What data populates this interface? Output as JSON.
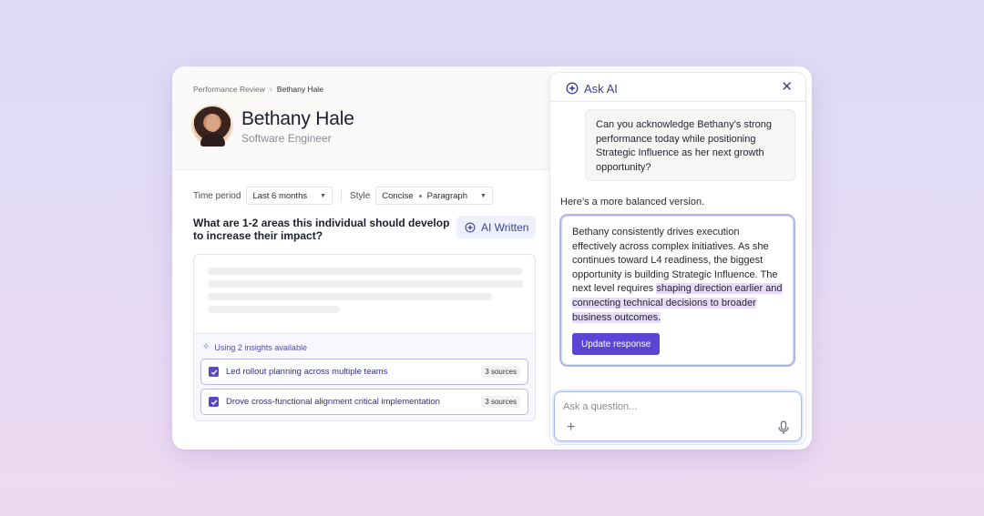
{
  "breadcrumb": {
    "parent": "Performance Review",
    "current": "Bethany Hale"
  },
  "profile": {
    "name": "Bethany Hale",
    "role": "Software Engineer"
  },
  "filters": {
    "time_label": "Time period",
    "time_value": "Last 6 months",
    "style_label": "Style",
    "style_value_1": "Concise",
    "style_value_2": "Paragraph"
  },
  "question": "What are 1-2 areas this individual should develop to increase their impact?",
  "ai_written_label": "AI Written",
  "insights": {
    "header": "Using 2 insights available",
    "items": [
      {
        "label": "Led rollout planning across multiple teams",
        "sources": "3 sources",
        "checked": true
      },
      {
        "label": "Drove cross-functional alignment critical implementation",
        "sources": "3 sources",
        "checked": true
      }
    ]
  },
  "ask_ai": {
    "title": "Ask AI",
    "user_message": "Can you acknowledge Bethany’s strong performance today while positioning Strategic Influence as her next growth opportunity?",
    "intro": "Here’s a more balanced version.",
    "response_plain": "Bethany consistently drives execution effectively across complex initiatives. As she continues toward L4 readiness, the biggest opportunity is building Strategic Influence. The next level requires ",
    "response_highlight": "shaping direction earlier and connecting technical decisions to broader business outcomes.",
    "update_button": "Update response",
    "input_placeholder": "Ask a question..."
  },
  "colors": {
    "accent": "#5b45d6",
    "ai_blue": "#3a3f98",
    "highlight": "#e6dcf7"
  },
  "icons": [
    "ai-sparkle-icon",
    "close-icon",
    "chevron-right-icon",
    "caret-down-icon",
    "checkbox-checked-icon",
    "plus-icon",
    "microphone-icon",
    "sparkle-icon"
  ]
}
